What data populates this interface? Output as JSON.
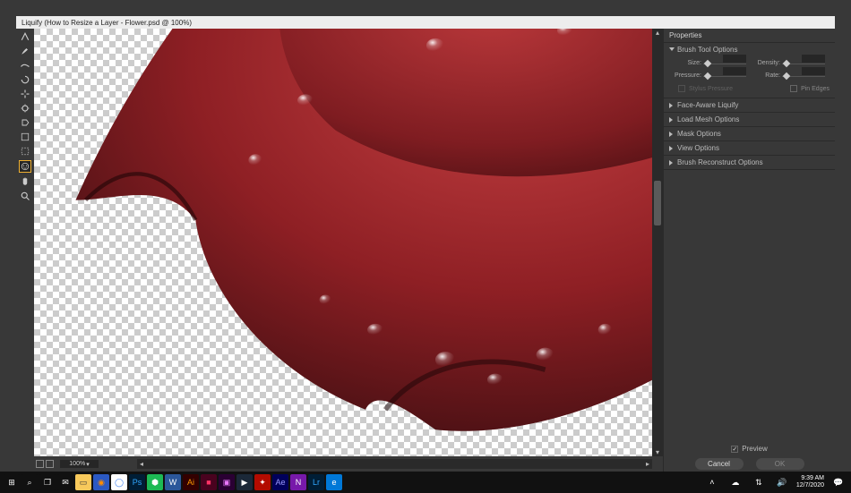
{
  "window": {
    "title": "Liquify (How to Resize a Layer - Flower.psd @ 100%)"
  },
  "toolbar": {
    "tools": [
      {
        "name": "forward-warp-tool",
        "icon": "warp"
      },
      {
        "name": "reconstruct-tool",
        "icon": "brush"
      },
      {
        "name": "smooth-tool",
        "icon": "smooth"
      },
      {
        "name": "twirl-tool",
        "icon": "twirl"
      },
      {
        "name": "pucker-tool",
        "icon": "pucker"
      },
      {
        "name": "bloat-tool",
        "icon": "bloat"
      },
      {
        "name": "push-left-tool",
        "icon": "push"
      },
      {
        "name": "freeze-mask-tool",
        "icon": "freeze"
      },
      {
        "name": "thaw-mask-tool",
        "icon": "thaw"
      },
      {
        "name": "face-tool",
        "icon": "face",
        "selected": true
      },
      {
        "name": "hand-tool",
        "icon": "hand"
      },
      {
        "name": "zoom-tool",
        "icon": "zoom"
      }
    ]
  },
  "canvas": {
    "zoom": "100%"
  },
  "panel": {
    "title": "Properties",
    "brush": {
      "title": "Brush Tool Options",
      "size_label": "Size:",
      "density_label": "Density:",
      "pressure_label": "Pressure:",
      "rate_label": "Rate:",
      "stylus_label": "Stylus Pressure",
      "pin_edges_label": "Pin Edges"
    },
    "sections": [
      {
        "key": "face_aware",
        "label": "Face-Aware Liquify"
      },
      {
        "key": "load_mesh",
        "label": "Load Mesh Options"
      },
      {
        "key": "mask",
        "label": "Mask Options"
      },
      {
        "key": "view",
        "label": "View Options"
      },
      {
        "key": "brush_reconstruct",
        "label": "Brush Reconstruct Options"
      }
    ],
    "preview_label": "Preview",
    "cancel_label": "Cancel",
    "ok_label": "OK"
  },
  "taskbar": {
    "apps": [
      {
        "name": "start",
        "bg": "#111",
        "fg": "#fff",
        "glyph": "⊞"
      },
      {
        "name": "search",
        "bg": "#111",
        "fg": "#fff",
        "glyph": "⌕"
      },
      {
        "name": "task-view",
        "bg": "#111",
        "fg": "#fff",
        "glyph": "❐"
      },
      {
        "name": "mail",
        "bg": "#111",
        "fg": "#fff",
        "glyph": "✉"
      },
      {
        "name": "file-explorer",
        "bg": "#f8c95b",
        "fg": "#333",
        "glyph": "▭"
      },
      {
        "name": "firefox",
        "bg": "#2b59c3",
        "fg": "#ff8c00",
        "glyph": "◉"
      },
      {
        "name": "chrome",
        "bg": "#fff",
        "fg": "#4285f4",
        "glyph": "◯"
      },
      {
        "name": "photoshop",
        "bg": "#001e36",
        "fg": "#31a8ff",
        "glyph": "Ps"
      },
      {
        "name": "dropbox",
        "bg": "#1db954",
        "fg": "#fff",
        "glyph": "⬢"
      },
      {
        "name": "word",
        "bg": "#2b579a",
        "fg": "#fff",
        "glyph": "W"
      },
      {
        "name": "illustrator",
        "bg": "#330000",
        "fg": "#ff9a00",
        "glyph": "Ai"
      },
      {
        "name": "indesign",
        "bg": "#49021f",
        "fg": "#ff3366",
        "glyph": "■"
      },
      {
        "name": "premiere",
        "bg": "#2a0033",
        "fg": "#ea77ff",
        "glyph": "▣"
      },
      {
        "name": "steam",
        "bg": "#1b2838",
        "fg": "#fff",
        "glyph": "▶"
      },
      {
        "name": "acrobat",
        "bg": "#b30b00",
        "fg": "#fff",
        "glyph": "✦"
      },
      {
        "name": "after-effects",
        "bg": "#00005b",
        "fg": "#9999ff",
        "glyph": "Ae"
      },
      {
        "name": "onenote",
        "bg": "#7719aa",
        "fg": "#fff",
        "glyph": "N"
      },
      {
        "name": "lightroom",
        "bg": "#001e36",
        "fg": "#31a8ff",
        "glyph": "Lr"
      },
      {
        "name": "edge",
        "bg": "#0078d7",
        "fg": "#fff",
        "glyph": "e"
      }
    ],
    "tray": {
      "up": "˄",
      "cloud": "☁",
      "net": "⇅",
      "speaker": "🔊",
      "time": "9:39 AM",
      "date": "12/7/2020",
      "notify": "💬"
    }
  }
}
